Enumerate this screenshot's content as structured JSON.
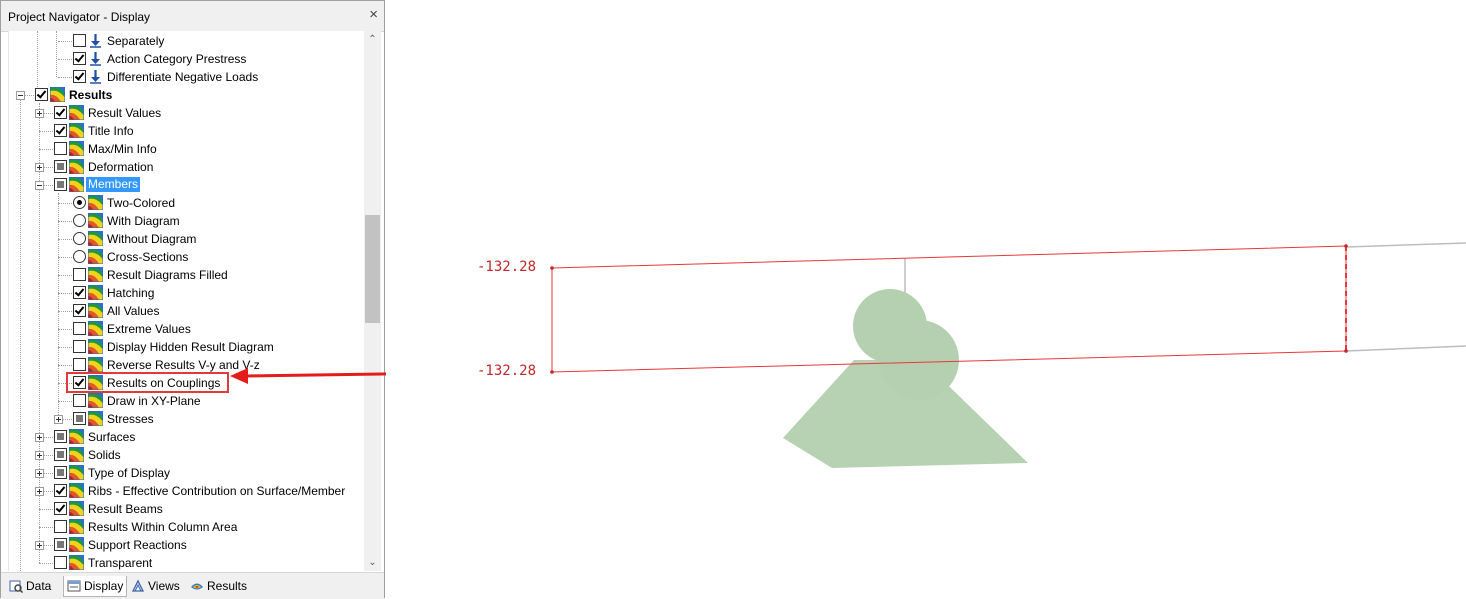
{
  "panel": {
    "title": "Project Navigator - Display",
    "close_glyph": "×"
  },
  "tree": {
    "items": [
      {
        "label": "Separately",
        "checked": false,
        "kind": "checkbox",
        "icon": "load-icon"
      },
      {
        "label": "Action Category Prestress",
        "checked": true,
        "kind": "checkbox",
        "icon": "load-icon"
      },
      {
        "label": "Differentiate Negative Loads",
        "checked": true,
        "kind": "checkbox",
        "icon": "load-icon"
      },
      {
        "label": "Results",
        "checked": true,
        "kind": "checkbox",
        "icon": "results-icon",
        "bold": true,
        "expanded": true
      },
      {
        "label": "Result Values",
        "checked": true,
        "kind": "checkbox",
        "icon": "results-icon",
        "expandable": true
      },
      {
        "label": "Title Info",
        "checked": true,
        "kind": "checkbox",
        "icon": "results-icon"
      },
      {
        "label": "Max/Min Info",
        "checked": false,
        "kind": "checkbox",
        "icon": "results-icon"
      },
      {
        "label": "Deformation",
        "checked": "partial",
        "kind": "checkbox",
        "icon": "results-icon",
        "expandable": true
      },
      {
        "label": "Members",
        "checked": "partial",
        "kind": "checkbox",
        "icon": "results-icon",
        "expanded": true,
        "selected": true
      },
      {
        "label": "Two-Colored",
        "checked": true,
        "kind": "radio",
        "icon": "results-icon"
      },
      {
        "label": "With Diagram",
        "checked": false,
        "kind": "radio",
        "icon": "results-icon"
      },
      {
        "label": "Without Diagram",
        "checked": false,
        "kind": "radio",
        "icon": "results-icon"
      },
      {
        "label": "Cross-Sections",
        "checked": false,
        "kind": "radio",
        "icon": "results-icon"
      },
      {
        "label": "Result Diagrams Filled",
        "checked": false,
        "kind": "checkbox",
        "icon": "results-icon"
      },
      {
        "label": "Hatching",
        "checked": true,
        "kind": "checkbox",
        "icon": "results-icon"
      },
      {
        "label": "All Values",
        "checked": true,
        "kind": "checkbox",
        "icon": "results-icon"
      },
      {
        "label": "Extreme Values",
        "checked": false,
        "kind": "checkbox",
        "icon": "results-icon"
      },
      {
        "label": "Display Hidden Result Diagram",
        "checked": false,
        "kind": "checkbox",
        "icon": "results-icon"
      },
      {
        "label": "Reverse Results V-y and V-z",
        "checked": false,
        "kind": "checkbox",
        "icon": "results-icon"
      },
      {
        "label": "Results on Couplings",
        "checked": true,
        "kind": "checkbox",
        "icon": "results-icon",
        "highlighted": true
      },
      {
        "label": "Draw in XY-Plane",
        "checked": false,
        "kind": "checkbox",
        "icon": "results-icon"
      },
      {
        "label": "Stresses",
        "checked": "partial",
        "kind": "checkbox",
        "icon": "results-icon",
        "expandable": true
      },
      {
        "label": "Surfaces",
        "checked": "partial",
        "kind": "checkbox",
        "icon": "results-icon",
        "expandable": true
      },
      {
        "label": "Solids",
        "checked": "partial",
        "kind": "checkbox",
        "icon": "results-icon",
        "expandable": true
      },
      {
        "label": "Type of Display",
        "checked": "partial",
        "kind": "checkbox",
        "icon": "results-icon",
        "expandable": true
      },
      {
        "label": "Ribs - Effective Contribution on Surface/Member",
        "checked": true,
        "kind": "checkbox",
        "icon": "results-icon",
        "expandable": true
      },
      {
        "label": "Result Beams",
        "checked": true,
        "kind": "checkbox",
        "icon": "results-icon"
      },
      {
        "label": "Results Within Column Area",
        "checked": false,
        "kind": "checkbox",
        "icon": "results-icon"
      },
      {
        "label": "Support Reactions",
        "checked": "partial",
        "kind": "checkbox",
        "icon": "results-icon",
        "expandable": true
      },
      {
        "label": "Transparent",
        "checked": false,
        "kind": "checkbox",
        "icon": "results-icon"
      }
    ]
  },
  "scrollbar": {
    "up_glyph": "⌃",
    "down_glyph": "⌄"
  },
  "tabs": [
    {
      "label": "Data",
      "icon": "data-icon"
    },
    {
      "label": "Display",
      "icon": "display-icon",
      "active": true
    },
    {
      "label": "Views",
      "icon": "views-icon"
    },
    {
      "label": "Results",
      "icon": "results-tab-icon"
    }
  ],
  "viewport": {
    "value_top": "-132.28",
    "value_bottom": "-132.28",
    "colors": {
      "result_line": "#e8383d",
      "support": "#b7d2b3",
      "member": "#a8a8a8",
      "arrow": "#e51c1c",
      "value_text": "#c1272d"
    }
  }
}
